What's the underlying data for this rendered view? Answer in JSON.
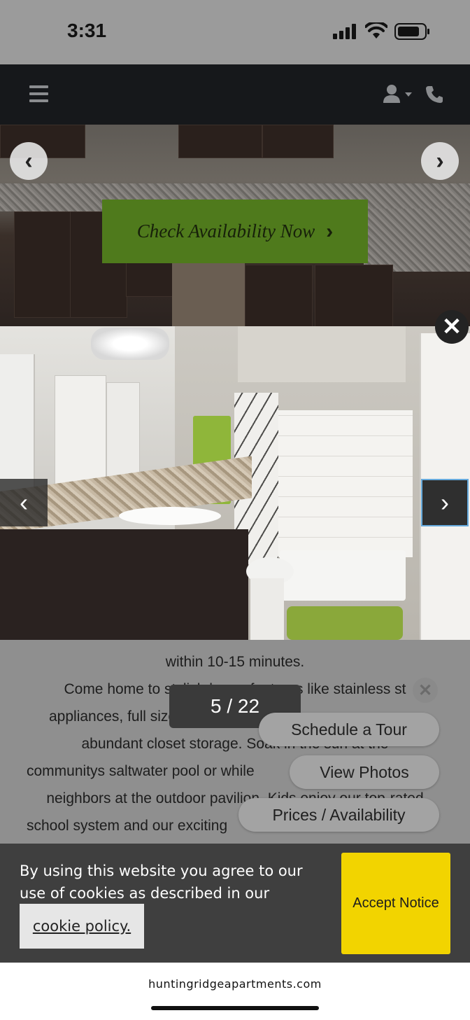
{
  "status_bar": {
    "time": "3:31"
  },
  "hero": {
    "cta_label": "Check Availability Now",
    "prev_glyph": "‹",
    "next_glyph": "›",
    "cta_chevron": "›"
  },
  "lightbox": {
    "counter": "5 / 22",
    "prev_glyph": "‹",
    "next_glyph": "›",
    "close_glyph": "✕"
  },
  "body_text": {
    "lines": [
      "within 10-15 minutes.",
      "Come home to stylish home features like stainless st",
      "appliances, full size washer/d",
      "abundant closet storage. Soak in the sun at the",
      "communitys saltwater pool or while",
      "neighbors at the outdoor pavilion. Kids enjoy our top-rated",
      "school system and our exciting"
    ]
  },
  "quick_actions": {
    "close_glyph": "✕",
    "schedule_tour": "Schedule a Tour",
    "view_photos": "View Photos",
    "prices": "Prices / Availability"
  },
  "cookie_banner": {
    "text": "By using this website you agree to our use of cookies as described in our",
    "link_label": "cookie policy.",
    "accept_label": "Accept Notice"
  },
  "browser": {
    "url": "huntingridgeapartments.com"
  },
  "colors": {
    "cta_green": "#4f7a1c",
    "accept_yellow": "#f2d400",
    "nav_dark": "#16181b"
  }
}
